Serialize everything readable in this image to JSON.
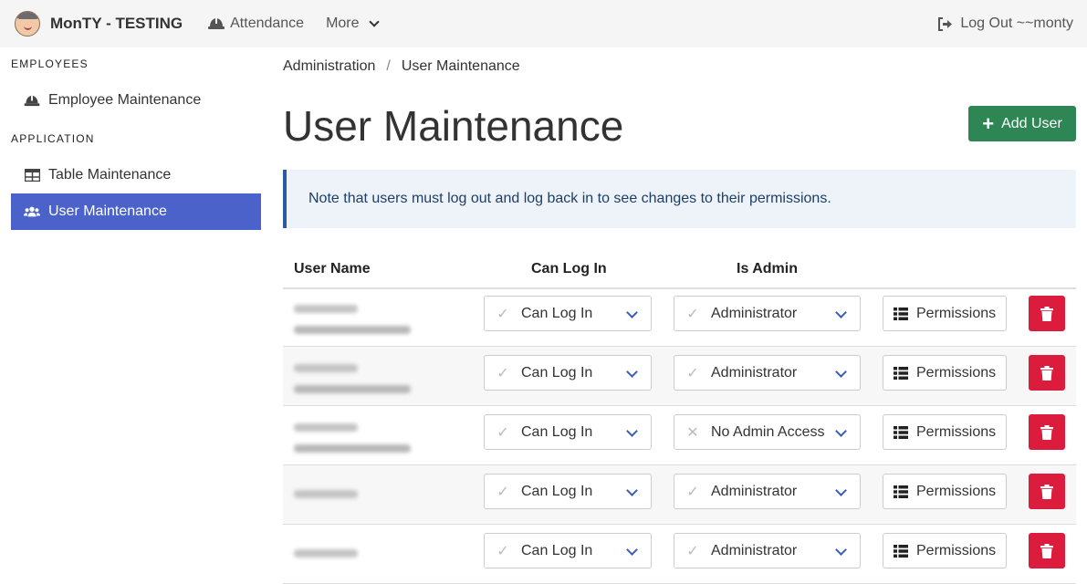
{
  "navbar": {
    "brand": "MonTY - TESTING",
    "attendance": "Attendance",
    "more": "More",
    "logout": "Log Out ~~monty"
  },
  "sidebar": {
    "sections": [
      {
        "heading": "EMPLOYEES",
        "items": [
          {
            "label": "Employee Maintenance",
            "icon": "hard-hat-icon"
          }
        ]
      },
      {
        "heading": "APPLICATION",
        "items": [
          {
            "label": "Table Maintenance",
            "icon": "table-icon"
          },
          {
            "label": "User Maintenance",
            "icon": "users-icon",
            "active": true
          }
        ]
      }
    ]
  },
  "breadcrumb": {
    "items": [
      "Administration",
      "User Maintenance"
    ]
  },
  "page": {
    "title": "User Maintenance",
    "add_user": "Add User",
    "note": "Note that users must log out and log back in to see changes to their permissions."
  },
  "table": {
    "headers": {
      "user_name": "User Name",
      "can_log_in": "Can Log In",
      "is_admin": "Is Admin"
    },
    "rows": [
      {
        "login": "Can Log In",
        "login_check": true,
        "admin": "Administrator",
        "admin_check": true,
        "permissions": "Permissions",
        "two_line_name": true
      },
      {
        "login": "Can Log In",
        "login_check": true,
        "admin": "Administrator",
        "admin_check": true,
        "permissions": "Permissions",
        "two_line_name": true
      },
      {
        "login": "Can Log In",
        "login_check": true,
        "admin": "No Admin Access",
        "admin_check": false,
        "permissions": "Permissions",
        "two_line_name": true
      },
      {
        "login": "Can Log In",
        "login_check": true,
        "admin": "Administrator",
        "admin_check": true,
        "permissions": "Permissions",
        "two_line_name": false
      },
      {
        "login": "Can Log In",
        "login_check": true,
        "admin": "Administrator",
        "admin_check": true,
        "permissions": "Permissions",
        "two_line_name": false
      }
    ]
  },
  "colors": {
    "active_nav": "#4a62c9",
    "add_button": "#2d8653",
    "delete_button": "#dc1c3c",
    "note_border": "#2a5aa0",
    "select_arrow": "#3b5bc0"
  }
}
